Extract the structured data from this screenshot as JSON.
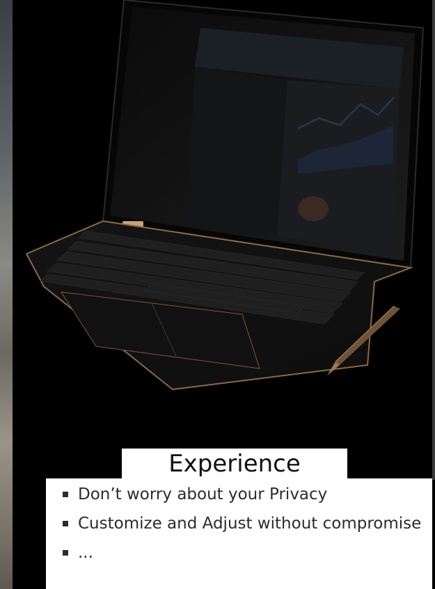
{
  "slide": {
    "title": "Experience",
    "bullets": [
      "Don’t worry about your Privacy",
      "Customize and Adjust without compromise",
      "..."
    ]
  },
  "image": {
    "subject": "laptop-with-stylus-photo"
  },
  "colors": {
    "background": "#000000",
    "text_box": "#ffffff",
    "text": "#2b2b2b",
    "accent_copper": "#c9a27a"
  }
}
